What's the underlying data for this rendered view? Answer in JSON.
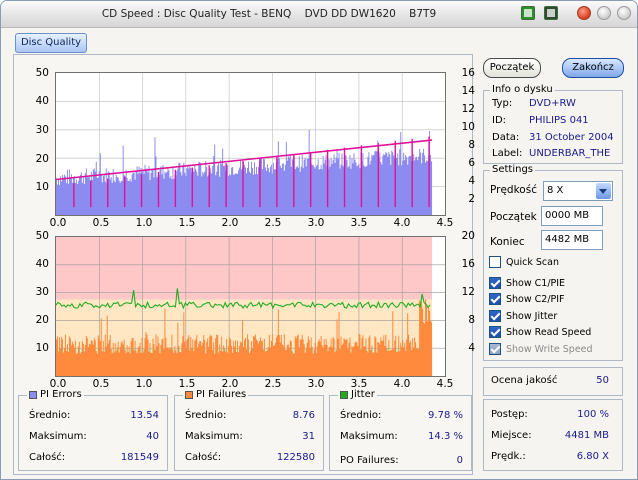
{
  "window": {
    "title": "CD Speed : Disc Quality Test - BENQ    DVD DD DW1620    B7T9"
  },
  "tabs": {
    "disc_quality": "Disc Quality"
  },
  "buttons": {
    "start": "Początek",
    "end": "Zakończ"
  },
  "graph1": {
    "y_left_ticks": [
      "50",
      "40",
      "30",
      "20",
      "10"
    ],
    "y_right_ticks": [
      "16",
      "14",
      "12",
      "10",
      "8",
      "6",
      "4",
      "2"
    ]
  },
  "graph2": {
    "y_left_ticks": [
      "50",
      "40",
      "30",
      "20",
      "10"
    ],
    "y_right_ticks": [
      "20",
      "16",
      "12",
      "8",
      "4"
    ]
  },
  "x_ticks": [
    "0.0",
    "0.5",
    "1.0",
    "1.5",
    "2.0",
    "2.5",
    "3.0",
    "3.5",
    "4.0",
    "4.5"
  ],
  "colors": {
    "pi_errors": "#8c8cf0",
    "read_speed": "#e0109a",
    "pi_failures": "#ff8a3d",
    "jitter": "#22aa22",
    "band_red": "#ffc8c8",
    "band_yellow": "#ffe7c3",
    "band_green": "#c8f5c8"
  },
  "stats": {
    "pi_errors": {
      "title": "PI Errors",
      "avg_label": "Średnio:",
      "avg": "13.54",
      "max_label": "Maksimum:",
      "max": "40",
      "total_label": "Całość:",
      "total": "181549"
    },
    "pi_failures": {
      "title": "PI Failures",
      "avg_label": "Średnio:",
      "avg": "8.76",
      "max_label": "Maksimum:",
      "max": "31",
      "total_label": "Całość:",
      "total": "122580"
    },
    "jitter": {
      "title": "Jitter",
      "avg_label": "Średnio:",
      "avg": "9.78 %",
      "max_label": "Maksimum:",
      "max": "14.3 %",
      "po_label": "PO Failures:",
      "po": "0"
    }
  },
  "info": {
    "title": "Info o dysku",
    "type_label": "Typ:",
    "type": "DVD+RW",
    "id_label": "ID:",
    "id": "PHILIPS 041",
    "date_label": "Data:",
    "date": "31 October 2004",
    "disc_label": "Label:",
    "disc": "UNDERBAR_THE"
  },
  "settings": {
    "title": "Settings",
    "speed_label": "Prędkość",
    "speed": "8 X",
    "start_label": "Początek",
    "start": "0000 MB",
    "end_label": "Koniec",
    "end": "4482 MB",
    "checks": [
      {
        "label": "Quick Scan",
        "checked": false,
        "dim": false
      },
      {
        "label": "Show C1/PIE",
        "checked": true,
        "dim": false
      },
      {
        "label": "Show C2/PIF",
        "checked": true,
        "dim": false
      },
      {
        "label": "Show Jitter",
        "checked": true,
        "dim": false
      },
      {
        "label": "Show Read Speed",
        "checked": true,
        "dim": false
      },
      {
        "label": "Show Write Speed",
        "checked": true,
        "dim": true
      }
    ]
  },
  "quality": {
    "label": "Ocena jakość",
    "value": "50"
  },
  "progress": {
    "progress_label": "Postęp:",
    "progress": "100 %",
    "position_label": "Miejsce:",
    "position": "4481 MB",
    "speed_label": "Prędk.:",
    "speed": "6.80 X"
  }
}
